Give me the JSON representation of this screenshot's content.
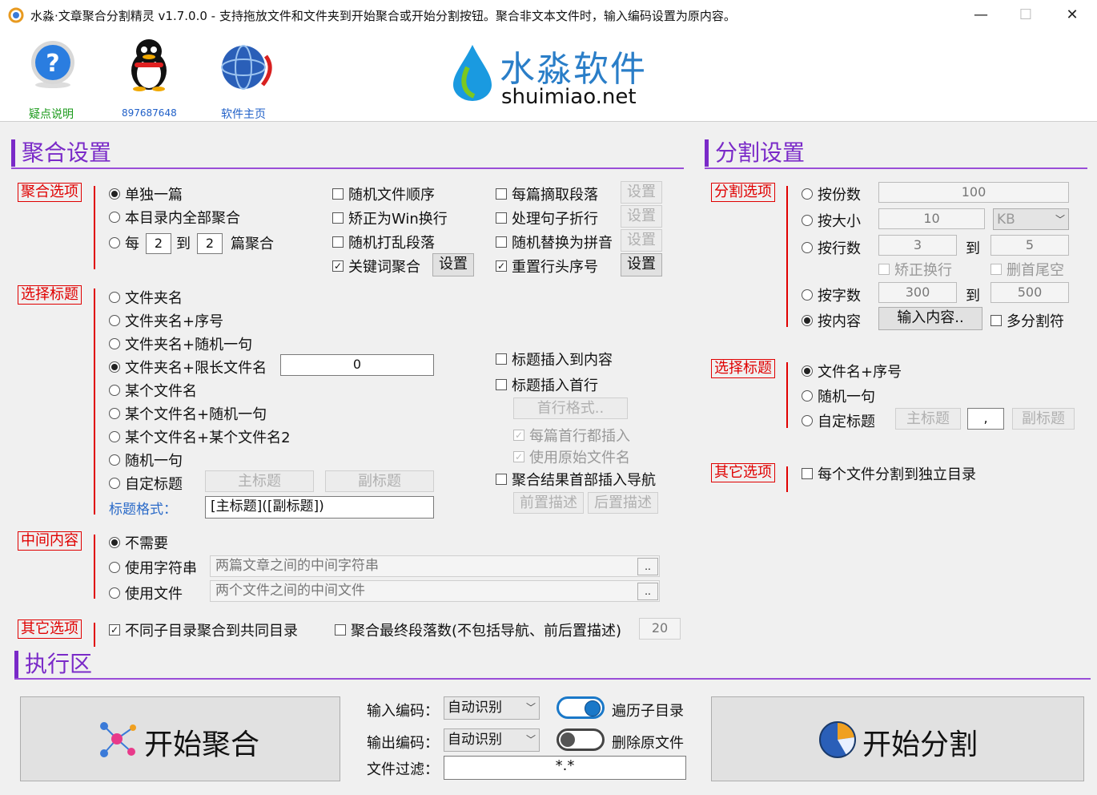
{
  "window": {
    "title": "水淼·文章聚合分割精灵 v1.7.0.0 - 支持拖放文件和文件夹到开始聚合或开始分割按钮。聚合非文本文件时，输入编码设置为原内容。",
    "min": "—",
    "max": "☐",
    "close": "✕"
  },
  "toolbar": {
    "help": "疑点说明",
    "qq": "897687648",
    "home": "软件主页"
  },
  "logo": {
    "cn": "水淼软件",
    "en": "shuimiao.net"
  },
  "merge": {
    "heading": "聚合设置",
    "options": {
      "label": "聚合选项",
      "single": "单独一篇",
      "all": "本目录内全部聚合",
      "every": "每",
      "every_n": "2",
      "to": "到",
      "every_m": "2",
      "suffix": "篇聚合",
      "random_order": "随机文件顺序",
      "fix_newline": "矫正为Win换行",
      "shuffle_para": "随机打乱段落",
      "keyword": "关键词聚合",
      "extract_para": "每篇摘取段落",
      "split_sentence": "处理句子折行",
      "pinyin": "随机替换为拼音",
      "renumber": "重置行头序号",
      "set": "设置"
    },
    "title": {
      "label": "选择标题",
      "folder": "文件夹名",
      "folder_seq": "文件夹名+序号",
      "folder_rand": "文件夹名+随机一句",
      "folder_limit": "文件夹名+限长文件名",
      "limit_value": "0",
      "some_file": "某个文件名",
      "some_file_rand": "某个文件名+随机一句",
      "some_file2": "某个文件名+某个文件名2",
      "random": "随机一句",
      "custom": "自定标题",
      "main_title": "主标题",
      "sub_title": "副标题",
      "format_label": "标题格式：",
      "format_value": "[主标题]([副标题])",
      "insert_content": "标题插入到内容",
      "insert_first": "标题插入首行",
      "first_format": "首行格式..",
      "each_first": "每篇首行都插入",
      "use_orig": "使用原始文件名",
      "nav": "聚合结果首部插入导航",
      "pre_desc": "前置描述",
      "post_desc": "后置描述"
    },
    "middle": {
      "label": "中间内容",
      "none": "不需要",
      "use_string": "使用字符串",
      "string_placeholder": "两篇文章之间的中间字符串",
      "use_file": "使用文件",
      "file_placeholder": "两个文件之间的中间文件",
      "browse": ".."
    },
    "other": {
      "label": "其它选项",
      "diff_dir": "不同子目录聚合到共同目录",
      "final_para": "聚合最终段落数(不包括导航、前后置描述)",
      "final_value": "20"
    }
  },
  "split": {
    "heading": "分割设置",
    "options": {
      "label": "分割选项",
      "by_count": "按份数",
      "count_value": "100",
      "by_size": "按大小",
      "size_value": "10",
      "size_unit": "KB",
      "by_lines": "按行数",
      "lines_from": "3",
      "to": "到",
      "lines_to": "5",
      "fix_newline": "矫正换行",
      "trim_tail": "删首尾空",
      "by_chars": "按字数",
      "chars_from": "300",
      "chars_to": "500",
      "by_content": "按内容",
      "input_content": "输入内容..",
      "multi_sep": "多分割符"
    },
    "title": {
      "label": "选择标题",
      "name_seq": "文件名+序号",
      "random": "随机一句",
      "custom": "自定标题",
      "main_title": "主标题",
      "sep": ",",
      "sub_title": "副标题"
    },
    "other": {
      "label": "其它选项",
      "own_dir": "每个文件分割到独立目录"
    }
  },
  "exec": {
    "heading": "执行区",
    "start_merge": "开始聚合",
    "start_split": "开始分割",
    "input_enc_label": "输入编码：",
    "input_enc": "自动识别",
    "output_enc_label": "输出编码：",
    "output_enc": "自动识别",
    "filter_label": "文件过滤：",
    "filter": "*.*",
    "recurse": "遍历子目录",
    "delete_src": "删除原文件"
  },
  "colors": {
    "accent": "#7a2ac8",
    "group": "#e00000",
    "toggle_on": "#1a78c8"
  }
}
